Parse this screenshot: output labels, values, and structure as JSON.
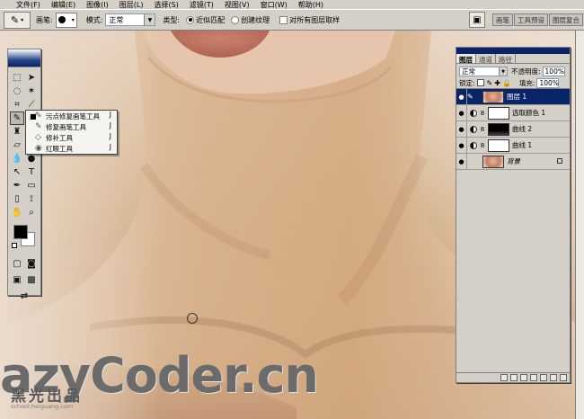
{
  "menubar": {
    "items": [
      "文件(F)",
      "编辑(E)",
      "图像(I)",
      "图层(L)",
      "选择(S)",
      "滤镜(T)",
      "视图(V)",
      "窗口(W)",
      "帮助(H)"
    ]
  },
  "options": {
    "brush_label": "画笔:",
    "brush_size": "9",
    "mode_label": "模式:",
    "mode_value": "正常",
    "type_label": "类型:",
    "type_options": [
      "近似匹配",
      "创建纹理"
    ],
    "type_selected": "近似匹配",
    "sample_all_label": "对所有图层取样",
    "sample_all_checked": false,
    "well_tabs": [
      "画笔",
      "工具预设",
      "图层复合"
    ]
  },
  "flyout": {
    "items": [
      {
        "label": "污点修复画笔工具",
        "shortcut": "J",
        "icon": "spot-healing-brush-icon",
        "active": true
      },
      {
        "label": "修复画笔工具",
        "shortcut": "J",
        "icon": "healing-brush-icon",
        "active": false
      },
      {
        "label": "修补工具",
        "shortcut": "J",
        "icon": "patch-icon",
        "active": false
      },
      {
        "label": "红眼工具",
        "shortcut": "J",
        "icon": "red-eye-icon",
        "active": false
      }
    ]
  },
  "layers_panel": {
    "tabs": [
      "图层",
      "通道",
      "路径"
    ],
    "blend_mode": "正常",
    "opacity_label": "不透明度:",
    "opacity_value": "100%",
    "lock_label": "锁定:",
    "fill_label": "填充:",
    "fill_value": "100%",
    "layers": [
      {
        "name": "图层 1",
        "selected": true,
        "adjustment": false,
        "thumb": "photo"
      },
      {
        "name": "选取颜色 1",
        "selected": false,
        "adjustment": true,
        "thumb": "white"
      },
      {
        "name": "曲线 2",
        "selected": false,
        "adjustment": true,
        "thumb": "black"
      },
      {
        "name": "曲线 1",
        "selected": false,
        "adjustment": true,
        "thumb": "white"
      },
      {
        "name": "背景",
        "selected": false,
        "adjustment": false,
        "thumb": "photo",
        "locked": true
      }
    ]
  },
  "watermark": {
    "site": "azyCoder.cn",
    "logo_cn": "黑光出品",
    "logo_url": "school.heiguang.com"
  },
  "colors": {
    "ui_gray": "#d4d0c8",
    "selected_blue": "#0a246a",
    "skin_light": "#e7d2bf",
    "skin_dark": "#c59a72"
  }
}
